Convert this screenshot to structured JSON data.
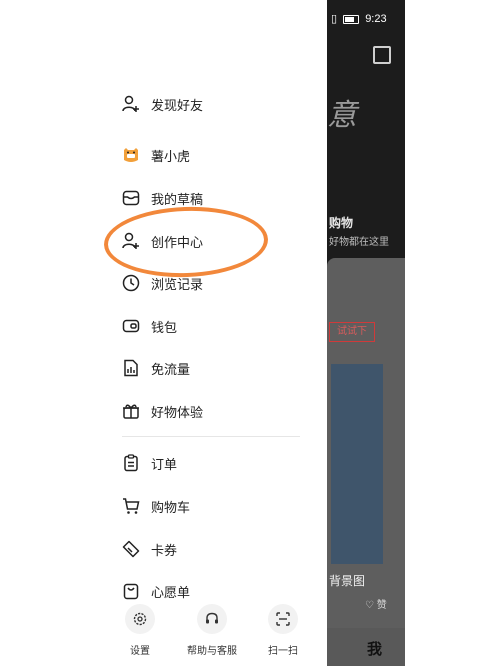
{
  "status_bar": {
    "time": "9:23"
  },
  "menu": {
    "discover_friends": "发现好友",
    "profile_name": "薯小虎",
    "drafts": "我的草稿",
    "creator_center": "创作中心",
    "history": "浏览记录",
    "wallet": "钱包",
    "free_data": "免流量",
    "product_trial": "好物体验",
    "orders": "订单",
    "cart": "购物车",
    "coupons": "卡券",
    "wishlist": "心愿单"
  },
  "bottom_bar": {
    "settings": "设置",
    "help": "帮助与客服",
    "scan": "扫一扫"
  },
  "background_app": {
    "shop_title": "购物",
    "shop_subtitle": "好物都在这里",
    "tag": "试试下",
    "deco_text": "意",
    "card_title": "背景图",
    "like": "赞",
    "tab_me": "我"
  },
  "colors": {
    "highlight": "#f2883b"
  }
}
